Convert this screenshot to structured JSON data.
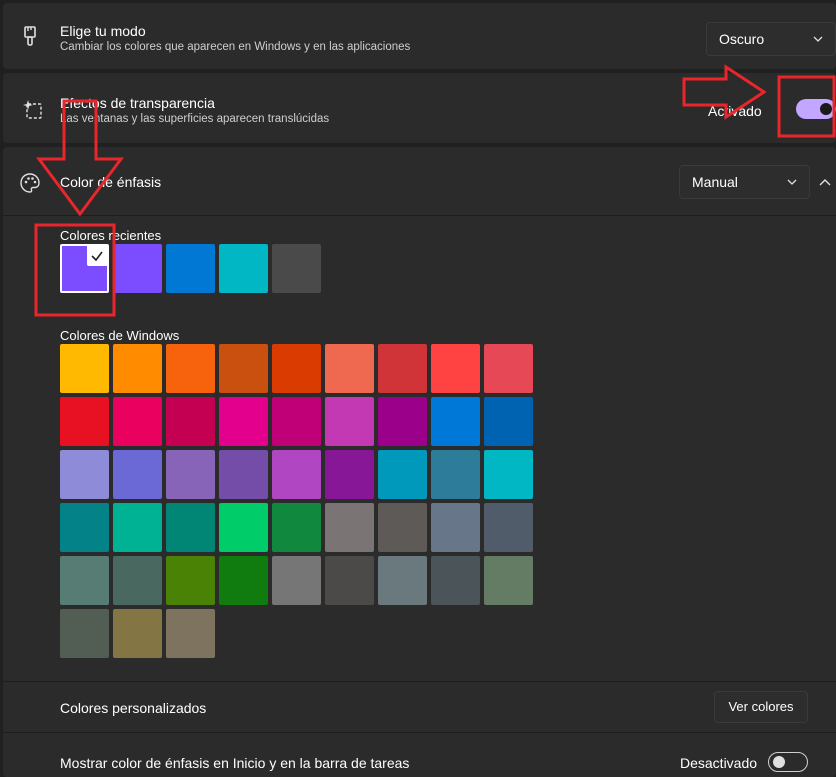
{
  "theme_row": {
    "title": "Elige tu modo",
    "subtitle": "Cambiar los colores que aparecen en Windows y en las aplicaciones",
    "dropdown_value": "Oscuro",
    "icon": "brush-icon"
  },
  "transparency_row": {
    "title": "Efectos de transparencia",
    "subtitle": "Las ventanas y las superficies aparecen translúcidas",
    "state_label": "Activado",
    "toggle_on": true,
    "icon": "transparency-sparkle-icon"
  },
  "accent_row": {
    "title": "Color de énfasis",
    "dropdown_value": "Manual",
    "icon": "palette-icon"
  },
  "recent_colors": {
    "label": "Colores recientes",
    "colors": [
      "#7c4dff",
      "#7c4dff",
      "#0078d4",
      "#00b7c3",
      "#4a4a4a"
    ],
    "selected_index": 0
  },
  "windows_colors": {
    "label": "Colores de Windows",
    "rows": [
      [
        "#ffb900",
        "#ff8c00",
        "#f7630c",
        "#ca5010",
        "#da3b01",
        "#ef6950",
        "#d13438",
        "#ff4343",
        "#e74856"
      ],
      [
        "#e81123",
        "#ea005e",
        "#c30052",
        "#e3008c",
        "#bf0077",
        "#c239b3",
        "#9a0089",
        "#0078d7",
        "#0063b1"
      ],
      [
        "#8e8cd8",
        "#6b69d6",
        "#8764b8",
        "#744da9",
        "#b146c2",
        "#881798",
        "#0099bc",
        "#2d7d9a",
        "#00b7c3"
      ],
      [
        "#038387",
        "#00b294",
        "#018574",
        "#00cc6a",
        "#10893e",
        "#7a7574",
        "#5d5a58",
        "#68768a",
        "#515c6b"
      ],
      [
        "#567c73",
        "#486860",
        "#498205",
        "#107c10",
        "#767676",
        "#4c4a48",
        "#69797e",
        "#4a5459",
        "#647c64"
      ],
      [
        "#525e54",
        "#847545",
        "#7e735f"
      ]
    ]
  },
  "custom_colors": {
    "label": "Colores personalizados",
    "button_label": "Ver colores"
  },
  "start_taskbar": {
    "label": "Mostrar color de énfasis en Inicio y en la barra de tareas",
    "state_label": "Desactivado",
    "toggle_on": false
  },
  "colors": {
    "accent": "#c3a6ff",
    "annotation_red": "#e8262b",
    "background": "#202020",
    "card": "#2b2b2b"
  }
}
